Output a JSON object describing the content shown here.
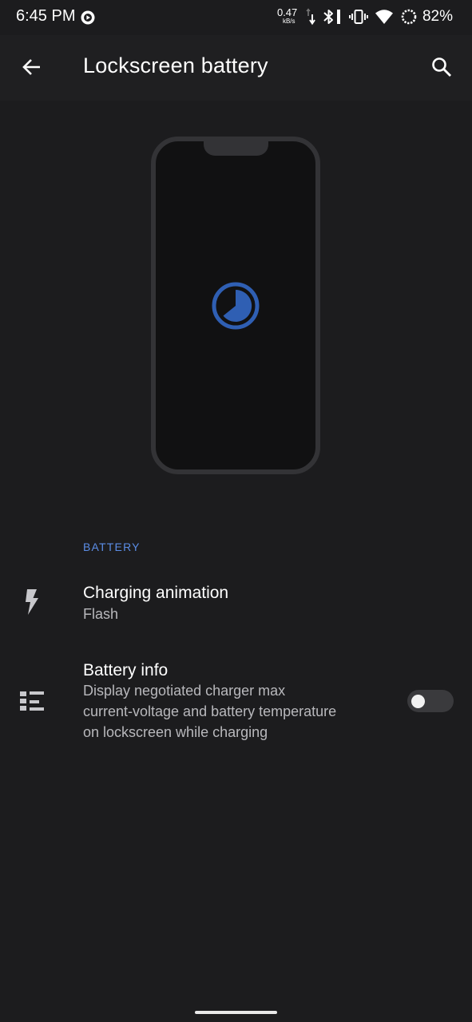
{
  "status_bar": {
    "time": "6:45 PM",
    "net_speed_value": "0.47",
    "net_speed_unit": "kB/s",
    "battery_percent": "82%",
    "icons": [
      "cast-icon",
      "network-activity-icon",
      "bluetooth-icon",
      "vibrate-icon",
      "wifi-icon",
      "battery-ring-icon"
    ]
  },
  "app_bar": {
    "title": "Lockscreen battery",
    "back_icon": "arrow-back-icon",
    "search_icon": "search-icon"
  },
  "preview": {
    "indicator_icon": "charging-progress-icon",
    "accent_color": "#2f5fb3"
  },
  "settings": {
    "section_title": "BATTERY",
    "charging_animation": {
      "icon": "flash-icon",
      "title": "Charging animation",
      "summary": "Flash"
    },
    "battery_info": {
      "icon": "list-icon",
      "title": "Battery info",
      "summary_lines": [
        "Display negotiated charger max",
        "current-voltage and battery temperature",
        "on lockscreen while charging"
      ],
      "toggle_on": false
    }
  },
  "colors": {
    "background": "#1c1c1e",
    "accent": "#5b8de6",
    "text_primary": "#ffffff",
    "text_secondary": "#b8b8bc"
  }
}
